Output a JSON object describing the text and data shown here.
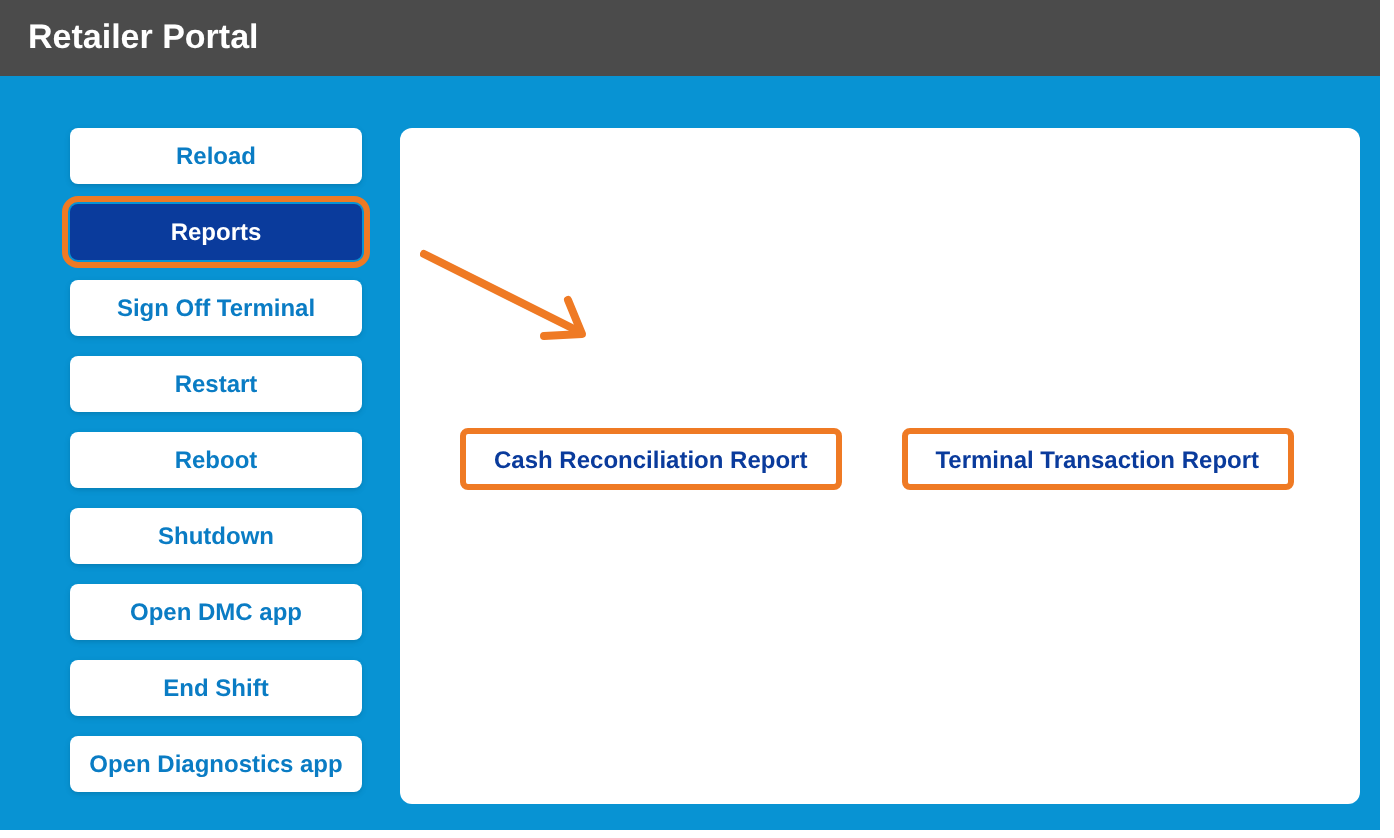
{
  "window": {
    "title": "Retailer Portal"
  },
  "sidebar": {
    "items": [
      {
        "label": "Reload",
        "selected": false,
        "highlighted": false
      },
      {
        "label": "Reports",
        "selected": true,
        "highlighted": true
      },
      {
        "label": "Sign Off Terminal",
        "selected": false,
        "highlighted": false
      },
      {
        "label": "Restart",
        "selected": false,
        "highlighted": false
      },
      {
        "label": "Reboot",
        "selected": false,
        "highlighted": false
      },
      {
        "label": "Shutdown",
        "selected": false,
        "highlighted": false
      },
      {
        "label": "Open DMC app",
        "selected": false,
        "highlighted": false
      },
      {
        "label": "End Shift",
        "selected": false,
        "highlighted": false
      },
      {
        "label": "Open Diagnostics app",
        "selected": false,
        "highlighted": false
      }
    ]
  },
  "content": {
    "arrow": true,
    "buttons": [
      {
        "label": "Cash Reconciliation Report",
        "highlighted": true
      },
      {
        "label": "Terminal Transaction Report",
        "highlighted": true
      }
    ]
  }
}
